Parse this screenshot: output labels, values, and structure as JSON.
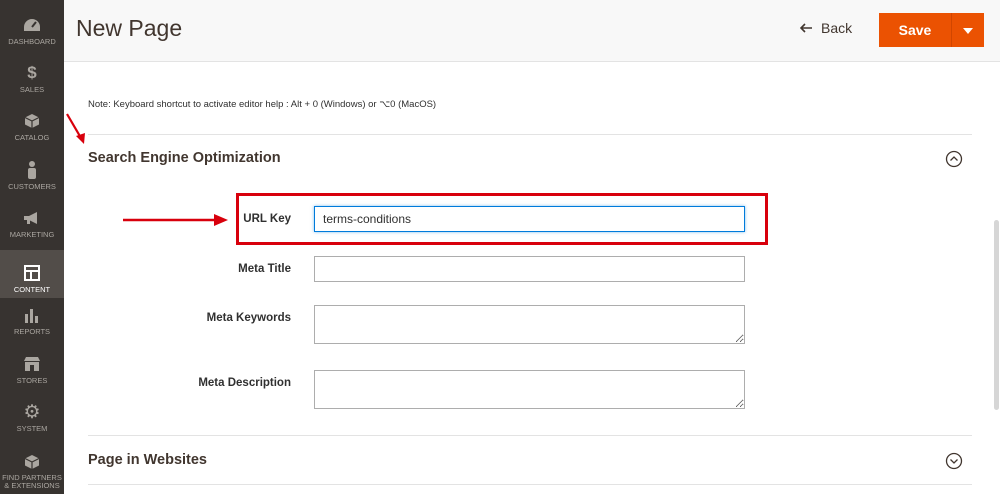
{
  "sidebar": {
    "items": [
      {
        "label": "DASHBOARD",
        "icon": "dashboard-icon"
      },
      {
        "label": "SALES",
        "icon": "dollar-icon"
      },
      {
        "label": "CATALOG",
        "icon": "box-icon"
      },
      {
        "label": "CUSTOMERS",
        "icon": "person-icon"
      },
      {
        "label": "MARKETING",
        "icon": "megaphone-icon"
      },
      {
        "label": "CONTENT",
        "icon": "layout-icon",
        "active": true
      },
      {
        "label": "REPORTS",
        "icon": "bar-chart-icon"
      },
      {
        "label": "STORES",
        "icon": "store-icon"
      },
      {
        "label": "SYSTEM",
        "icon": "gear-icon"
      },
      {
        "label": "FIND PARTNERS & EXTENSIONS",
        "icon": "cube-icon"
      }
    ]
  },
  "header": {
    "title": "New Page",
    "back_label": "Back",
    "save_label": "Save"
  },
  "main": {
    "note": "Note: Keyboard shortcut to activate editor help : Alt + 0 (Windows) or ⌥0 (MacOS)",
    "seo_section": {
      "title": "Search Engine Optimization",
      "url_key_label": "URL Key",
      "url_key_value": "terms-conditions",
      "meta_title_label": "Meta Title",
      "meta_title_value": "",
      "meta_keywords_label": "Meta Keywords",
      "meta_keywords_value": "",
      "meta_description_label": "Meta Description",
      "meta_description_value": ""
    },
    "websites_section": {
      "title": "Page in Websites"
    }
  },
  "colors": {
    "sidebar_bg": "#373330",
    "accent": "#eb5202",
    "annotation": "#d8000c"
  }
}
